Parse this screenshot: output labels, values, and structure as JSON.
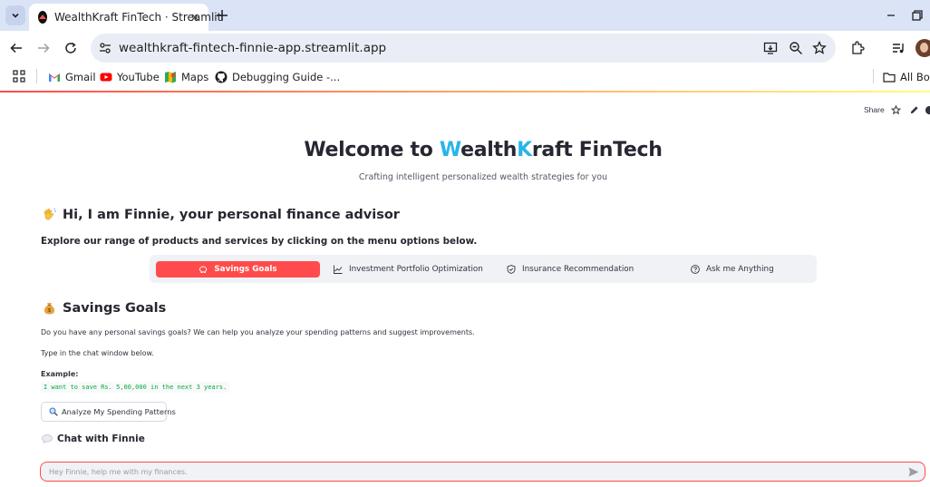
{
  "browser": {
    "tab_title": "WealthKraft FinTech · Streamlit",
    "url": "wealthkraft-fintech-finnie-app.streamlit.app",
    "bookmarks": [
      {
        "label": "Gmail",
        "icon": "gmail-icon"
      },
      {
        "label": "YouTube",
        "icon": "youtube-icon"
      },
      {
        "label": "Maps",
        "icon": "maps-icon"
      },
      {
        "label": "Debugging Guide -...",
        "icon": "github-icon"
      }
    ],
    "all_bookmarks_label": "All Boo"
  },
  "app_header": {
    "share_label": "Share"
  },
  "hero": {
    "title_prefix": "Welcome to ",
    "title_w": "W",
    "title_ealth": "ealth",
    "title_k": "K",
    "title_raft": "raft FinTech",
    "subtitle": "Crafting intelligent personalized wealth strategies for you"
  },
  "intro": {
    "greeting": "Hi, I am Finnie, your personal finance advisor",
    "explore_text": "Explore our range of products and services by clicking on the menu options below."
  },
  "menu": {
    "items": [
      {
        "label": "Savings Goals",
        "icon": "piggy-bank-icon",
        "active": true
      },
      {
        "label": "Investment Portfolio Optimization",
        "icon": "chart-line-icon",
        "active": false
      },
      {
        "label": "Insurance Recommendation",
        "icon": "shield-icon",
        "active": false
      },
      {
        "label": "Ask me Anything",
        "icon": "question-circle-icon",
        "active": false
      }
    ]
  },
  "savings": {
    "title": "Savings Goals",
    "description": "Do you have any personal savings goals? We can help you analyze your spending patterns and suggest improvements.",
    "instruction": "Type in the chat window below.",
    "example_label": "Example:",
    "example_code": "I want to save Rs. 5,00,000 in the next 3 years.",
    "analyze_button": "Analyze My Spending Patterns"
  },
  "chat": {
    "title": "Chat with Finnie",
    "placeholder": "Hey Finnie, help me with my finances."
  },
  "colors": {
    "accent_red": "#ff4b4b",
    "accent_blue": "#29b5e8",
    "code_green": "#09ab3b"
  }
}
